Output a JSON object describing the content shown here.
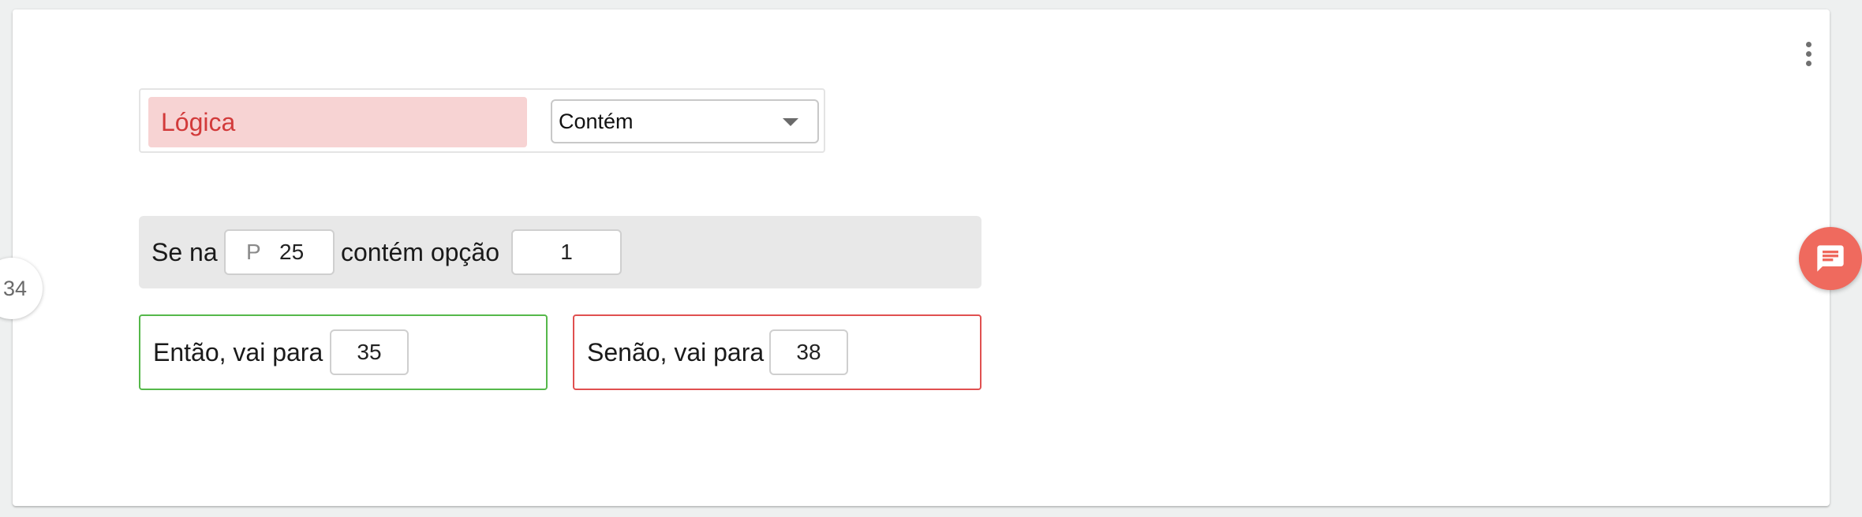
{
  "question_number": "34",
  "logic": {
    "label": "Lógica",
    "operator_selected": "Contém"
  },
  "condition": {
    "prefix_text": "Se na",
    "question_prefix": "P",
    "question_value": "25",
    "middle_text": "contém opção",
    "option_value": "1"
  },
  "then_branch": {
    "text": "Então, vai para",
    "target": "35"
  },
  "else_branch": {
    "text": "Senão, vai para",
    "target": "38"
  },
  "colors": {
    "logic_label_bg": "#f7d3d3",
    "logic_label_text": "#d23a3a",
    "then_border": "#55b84a",
    "else_border": "#e05050",
    "chat_button": "#ef6a5e"
  },
  "icons": {
    "more": "more-vertical-icon",
    "select_caret": "chevron-down-icon",
    "chat": "chat-icon"
  }
}
